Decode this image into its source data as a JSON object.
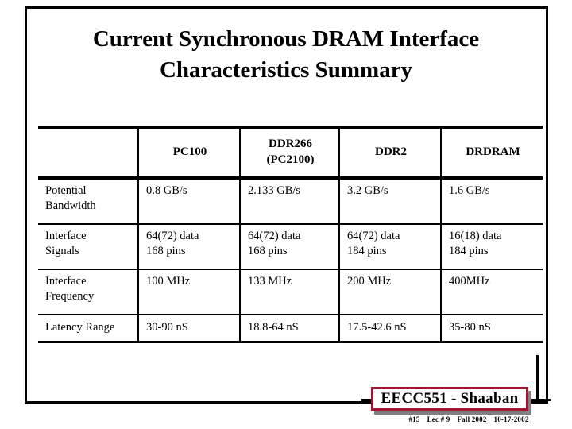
{
  "slide": {
    "title_line1": "Current Synchronous DRAM Interface",
    "title_line2": "Characteristics Summary"
  },
  "table": {
    "columns": [
      {
        "label_line1": "",
        "label_line2": ""
      },
      {
        "label_line1": "PC100",
        "label_line2": ""
      },
      {
        "label_line1": "DDR266",
        "label_line2": "(PC2100)"
      },
      {
        "label_line1": "DDR2",
        "label_line2": ""
      },
      {
        "label_line1": "DRDRAM",
        "label_line2": ""
      }
    ],
    "rows": [
      {
        "label_line1": "Potential",
        "label_line2": "Bandwidth",
        "cells": [
          {
            "line1": "0.8 GB/s",
            "line2": ""
          },
          {
            "line1": "2.133 GB/s",
            "line2": ""
          },
          {
            "line1": "3.2 GB/s",
            "line2": ""
          },
          {
            "line1": "1.6 GB/s",
            "line2": ""
          }
        ]
      },
      {
        "label_line1": "Interface",
        "label_line2": "Signals",
        "cells": [
          {
            "line1": "64(72) data",
            "line2": "168 pins"
          },
          {
            "line1": "64(72) data",
            "line2": "168 pins"
          },
          {
            "line1": "64(72) data",
            "line2": "184 pins"
          },
          {
            "line1": "16(18) data",
            "line2": "184 pins"
          }
        ]
      },
      {
        "label_line1": "Interface",
        "label_line2": "Frequency",
        "cells": [
          {
            "line1": "100 MHz",
            "line2": ""
          },
          {
            "line1": "133 MHz",
            "line2": ""
          },
          {
            "line1": "200 MHz",
            "line2": ""
          },
          {
            "line1": "400MHz",
            "line2": ""
          }
        ]
      },
      {
        "label_line1": "Latency Range",
        "label_line2": "",
        "cells": [
          {
            "line1": "30-90 nS",
            "line2": ""
          },
          {
            "line1": "18.8-64 nS",
            "line2": ""
          },
          {
            "line1": "17.5-42.6 nS",
            "line2": ""
          },
          {
            "line1": "35-80 nS",
            "line2": ""
          }
        ]
      }
    ]
  },
  "footer": {
    "badge_label": "EECC551 - Shaaban",
    "badge_border_color": "#a31432",
    "slide_number": "#15",
    "lecture": "Lec # 9",
    "term": "Fall 2002",
    "date": "10-17-2002"
  }
}
